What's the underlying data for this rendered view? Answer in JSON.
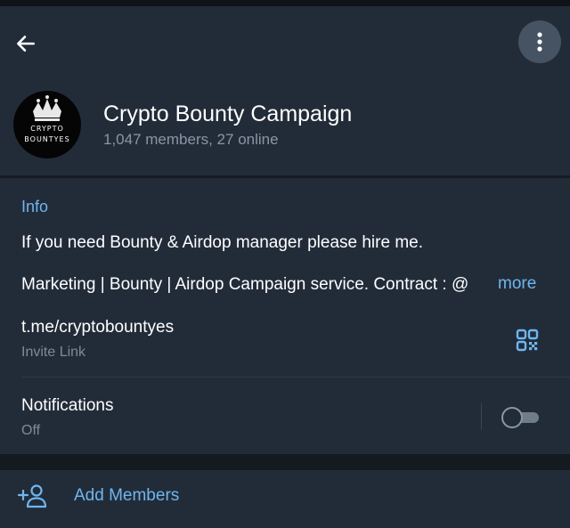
{
  "header": {
    "title": "Crypto Bounty Campaign",
    "subtitle": "1,047 members, 27 online",
    "avatar_line1": "CRYPTO",
    "avatar_line2": "BOUNTYES",
    "back_icon": "arrow-left-icon",
    "menu_icon": "more-vertical-icon"
  },
  "info": {
    "heading": "Info",
    "description_line1": "If you need Bounty & Airdop  manager please hire me.",
    "description_line2": "Marketing | Bounty | Airdop Campaign service.   Contract : @",
    "more_label": "more",
    "link": "t.me/cryptobountyes",
    "link_label": "Invite Link",
    "qr_icon": "qr-code-icon"
  },
  "notifications": {
    "label": "Notifications",
    "status": "Off",
    "enabled": false
  },
  "actions": {
    "add_members_label": "Add Members",
    "add_icon": "add-user-icon"
  },
  "colors": {
    "panel": "#222c39",
    "background": "#171c24",
    "accent": "#6fb6ee",
    "secondary_text": "#8896a4"
  }
}
